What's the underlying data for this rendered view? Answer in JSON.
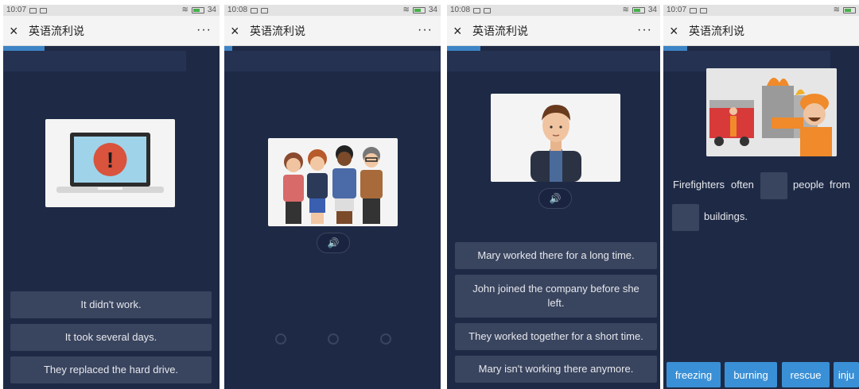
{
  "status": [
    {
      "time": "10:07",
      "battery": "34"
    },
    {
      "time": "10:08",
      "battery": "34"
    },
    {
      "time": "10:08",
      "battery": "34"
    },
    {
      "time": "10:07",
      "battery": ""
    }
  ],
  "app": {
    "title": "英语流利说",
    "close_icon": "×",
    "more_icon": "···"
  },
  "screen1": {
    "options": [
      "It didn't work.",
      "It took several days.",
      "They replaced the hard drive."
    ],
    "alert_glyph": "!"
  },
  "screen2": {
    "speaker_glyph": "🔊"
  },
  "screen3": {
    "speaker_glyph": "🔊",
    "options": [
      "Mary worked there for a long time.",
      "John joined the company before she left.",
      "They worked together for a short time.",
      "Mary isn't working there anymore."
    ]
  },
  "screen4": {
    "sentence": {
      "w1": "Firefighters",
      "w2": "often",
      "w3": "people",
      "w4": "from",
      "w5": "buildings."
    },
    "words": [
      "freezing",
      "burning",
      "rescue",
      "inju"
    ]
  },
  "colors": {
    "background": "#1e2a45",
    "option": "#39445e",
    "accent": "#3a90d6",
    "progress": "#3d84c6"
  }
}
